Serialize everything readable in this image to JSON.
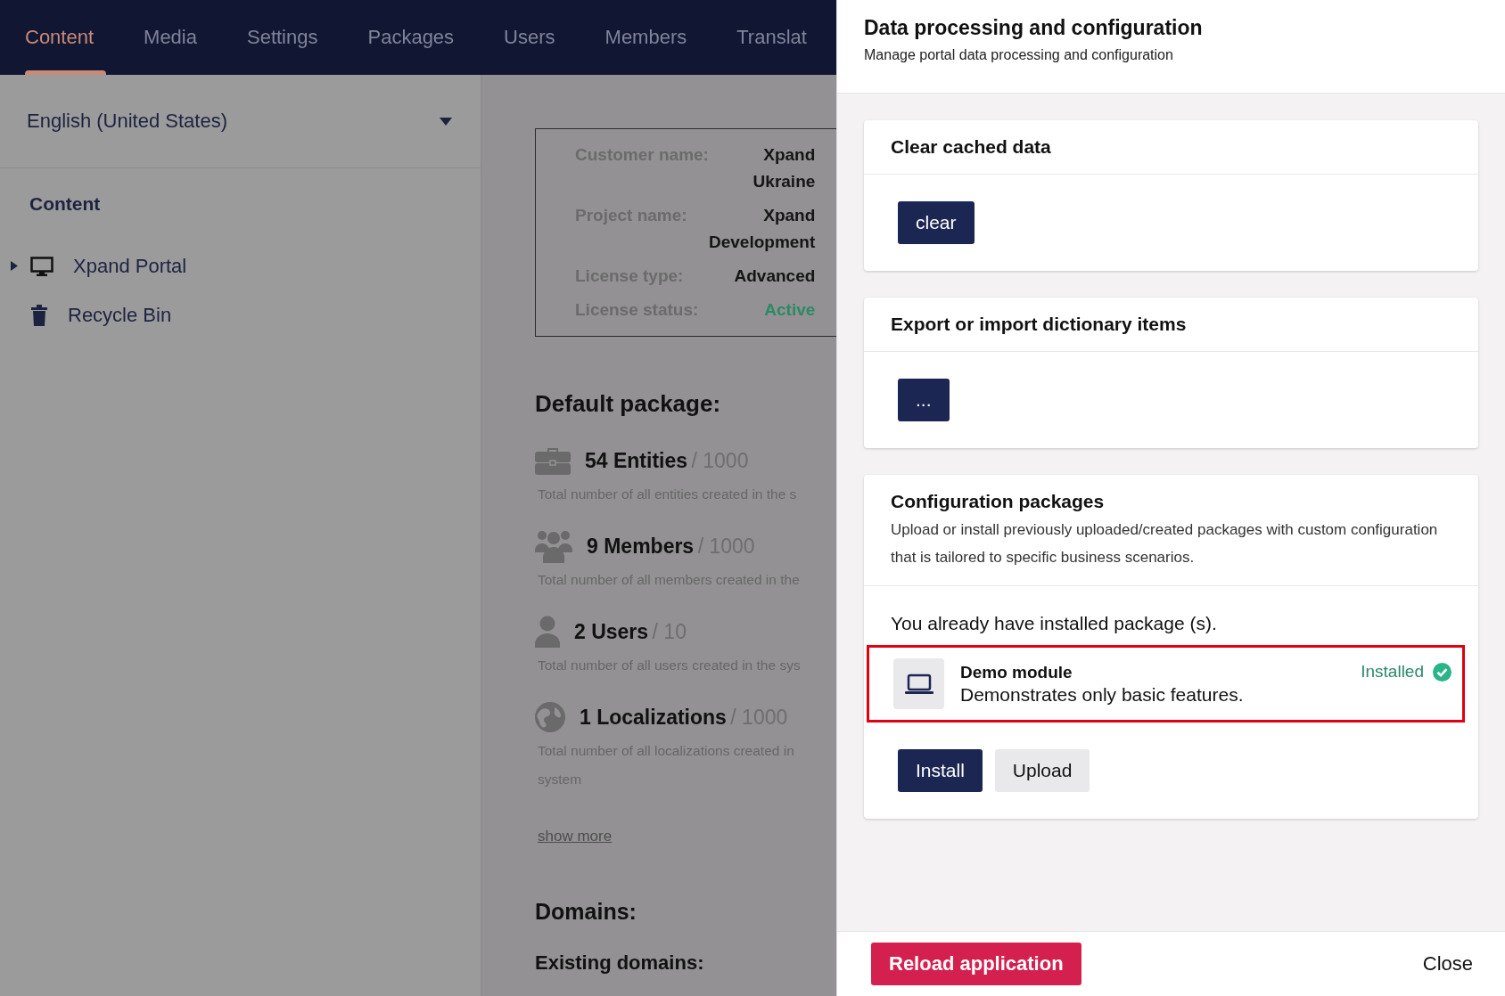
{
  "nav_tabs": [
    {
      "label": "Content",
      "selected": true
    },
    {
      "label": "Media",
      "selected": false
    },
    {
      "label": "Settings",
      "selected": false
    },
    {
      "label": "Packages",
      "selected": false
    },
    {
      "label": "Users",
      "selected": false
    },
    {
      "label": "Members",
      "selected": false
    },
    {
      "label": "Translat",
      "selected": false
    }
  ],
  "sidebar": {
    "language_select": {
      "value": "English (United States)"
    },
    "section_title": "Content",
    "tree": [
      {
        "label": "Xpand Portal",
        "expanded": false
      },
      {
        "label": "Recycle Bin"
      }
    ]
  },
  "license_info": [
    {
      "label": "Customer name:",
      "value": "Xpand Ukraine",
      "kind": "text"
    },
    {
      "label": "Project name:",
      "value": "Xpand Development",
      "kind": "text"
    },
    {
      "label": "License type:",
      "value": "Advanced",
      "kind": "text"
    },
    {
      "label": "License status:",
      "value": "Active",
      "kind": "status"
    }
  ],
  "default_package": {
    "title": "Default package:",
    "items": [
      {
        "count": "54 Entities",
        "limit": "/ 1000",
        "description": [
          "Total number of all entities created in the s"
        ]
      },
      {
        "count": "9 Members",
        "limit": "/ 1000",
        "description": [
          "Total number of all members created in the"
        ]
      },
      {
        "count": "2 Users",
        "limit": "/ 10",
        "description": [
          "Total number of all users created in the sys"
        ]
      },
      {
        "count": "1 Localizations",
        "limit": "/ 1000",
        "description": [
          "Total number of all localizations created in",
          "system"
        ]
      }
    ],
    "show_more": "show more"
  },
  "domains": {
    "title": "Domains:",
    "existing_title": "Existing domains:"
  },
  "panel": {
    "title": "Data processing and configuration",
    "subtitle": "Manage portal data processing and configuration",
    "cards": [
      {
        "kind": "action",
        "title": "Clear cached data",
        "button": "clear"
      },
      {
        "kind": "action",
        "title": "Export or import dictionary items",
        "button": "..."
      },
      {
        "kind": "packages",
        "title": "Configuration packages",
        "description": "Upload or install previously uploaded/created packages with custom configuration that is tailored to specific business scenarios.",
        "notice": "You already have installed package (s).",
        "packages": [
          {
            "name": "Demo module",
            "description": "Demonstrates only basic features.",
            "status": "Installed",
            "installed": true,
            "highlighted": true
          }
        ],
        "buttons": [
          {
            "label": "Install",
            "kind": "primary"
          },
          {
            "label": "Upload",
            "kind": "secondary"
          }
        ]
      }
    ],
    "footer": {
      "reload_button": "Reload application",
      "close_button": "Close"
    }
  }
}
